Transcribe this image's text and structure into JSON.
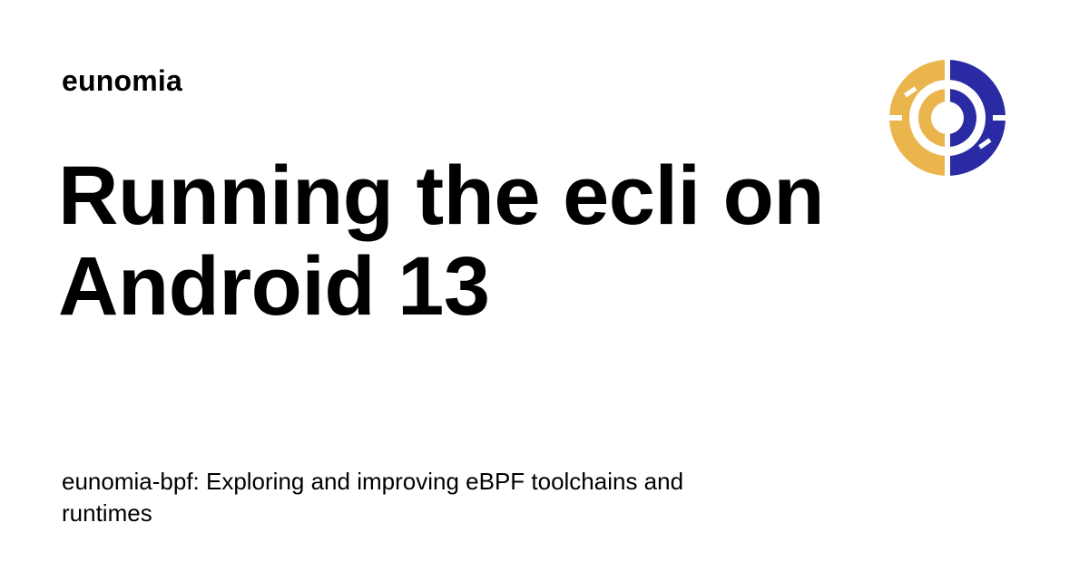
{
  "site": {
    "name": "eunomia"
  },
  "page": {
    "title": "Running the ecli on Android 13",
    "description": "eunomia-bpf: Exploring and improving eBPF toolchains and runtimes"
  },
  "logo": {
    "icon": "eunomia-logo-icon",
    "colors": {
      "left": "#EAB54C",
      "right": "#2A2AA4"
    }
  }
}
